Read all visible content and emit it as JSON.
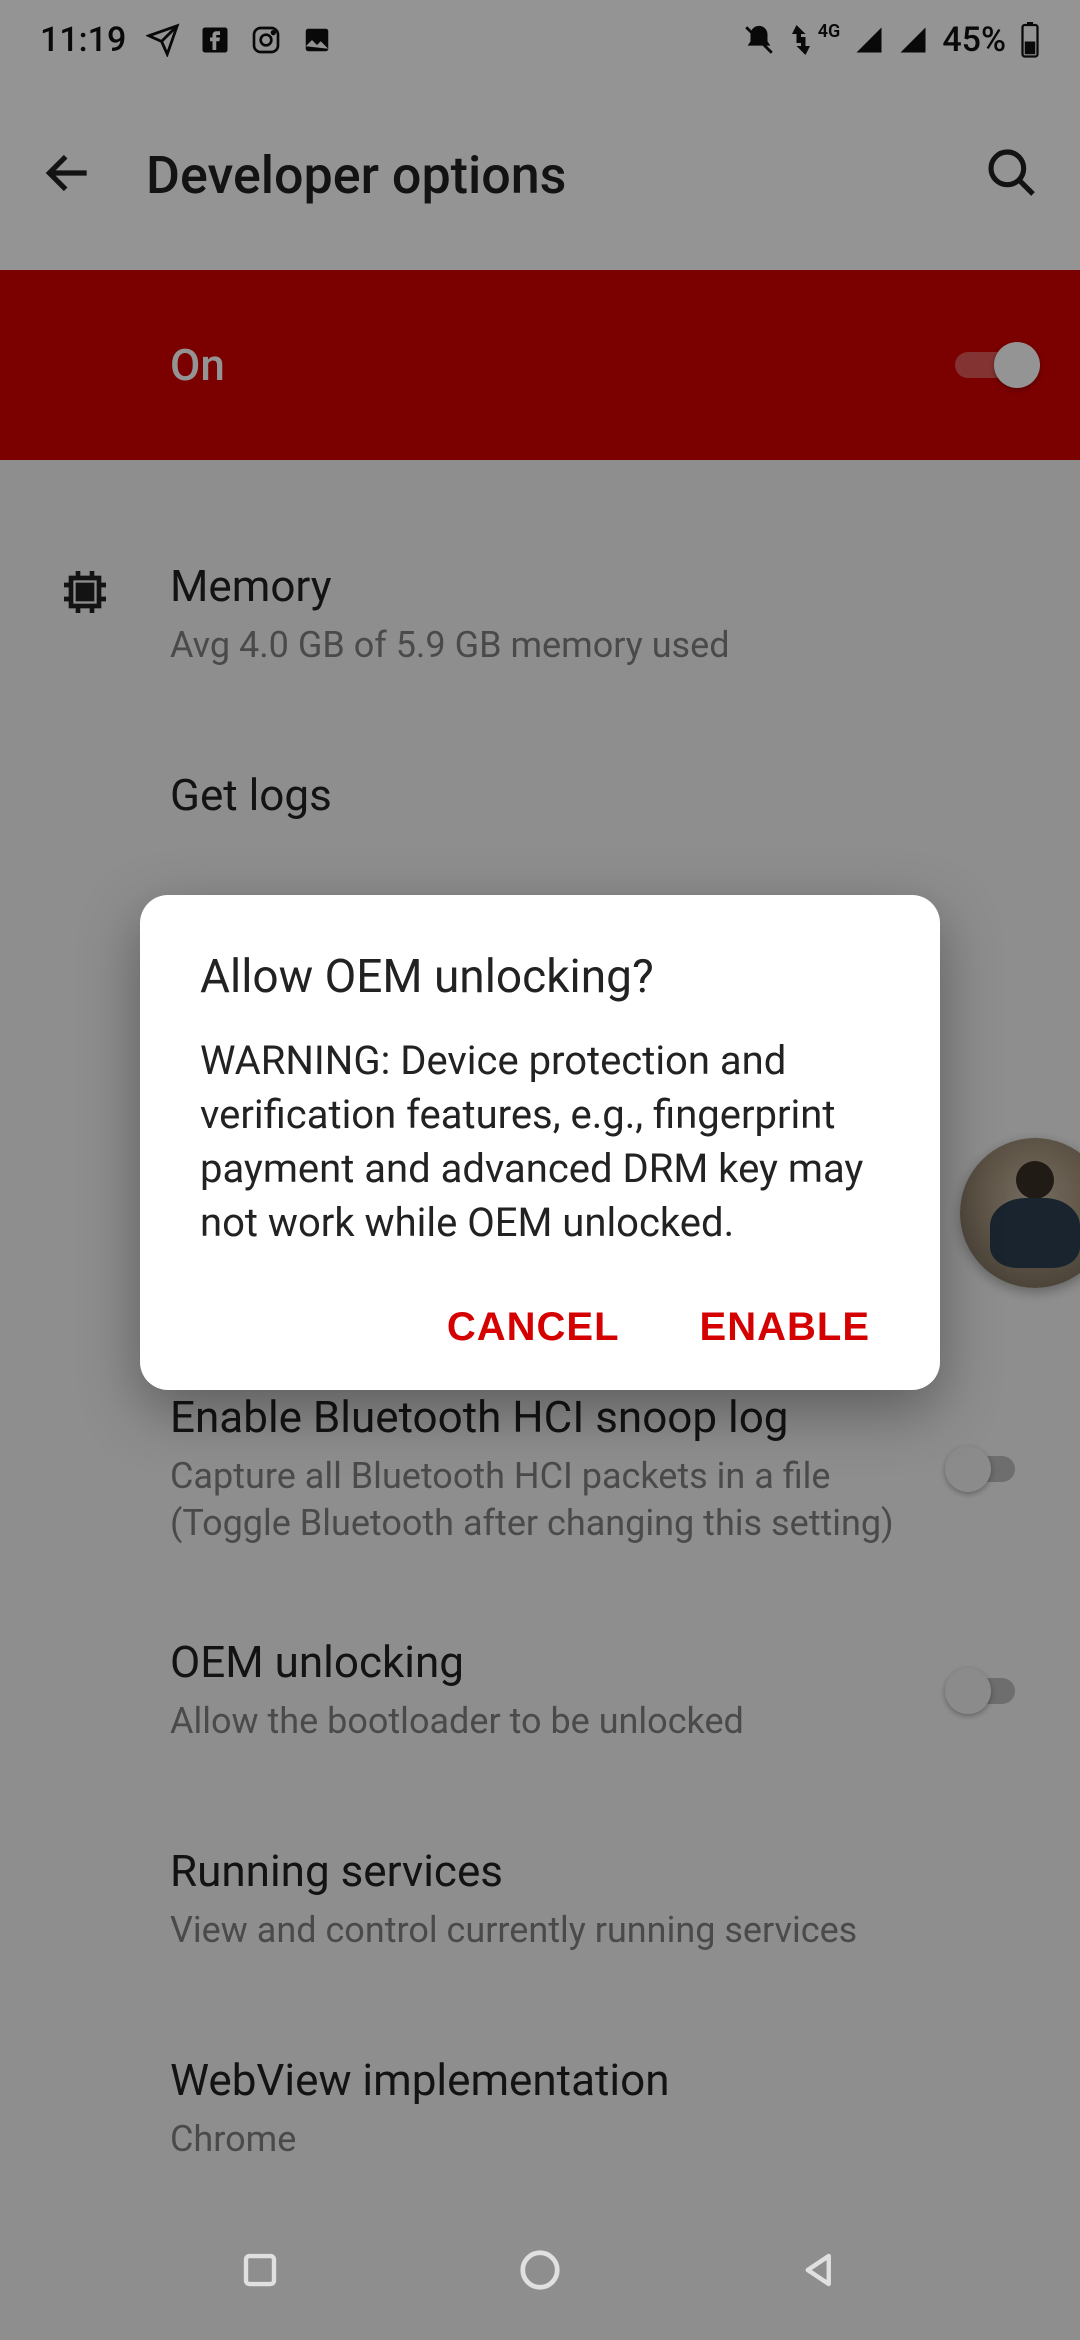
{
  "status": {
    "time": "11:19",
    "battery": "45%",
    "network_label": "4G"
  },
  "header": {
    "title": "Developer options"
  },
  "master": {
    "label": "On"
  },
  "memory": {
    "title": "Memory",
    "sub": "Avg 4.0 GB of 5.9 GB memory used"
  },
  "logs": {
    "title": "Get logs"
  },
  "hci": {
    "title": "Enable Bluetooth HCI snoop log",
    "sub": "Capture all Bluetooth HCI packets in a file (Toggle Bluetooth after changing this setting)"
  },
  "oem": {
    "title": "OEM unlocking",
    "sub": "Allow the bootloader to be unlocked"
  },
  "running": {
    "title": "Running services",
    "sub": "View and control currently running services"
  },
  "webview": {
    "title": "WebView implementation",
    "sub": "Chrome"
  },
  "dialog": {
    "title": "Allow OEM unlocking?",
    "body": "WARNING: Device protection and verification features, e.g., fingerprint payment and advanced DRM key may not work while OEM unlocked.",
    "cancel": "CANCEL",
    "enable": "ENABLE"
  }
}
